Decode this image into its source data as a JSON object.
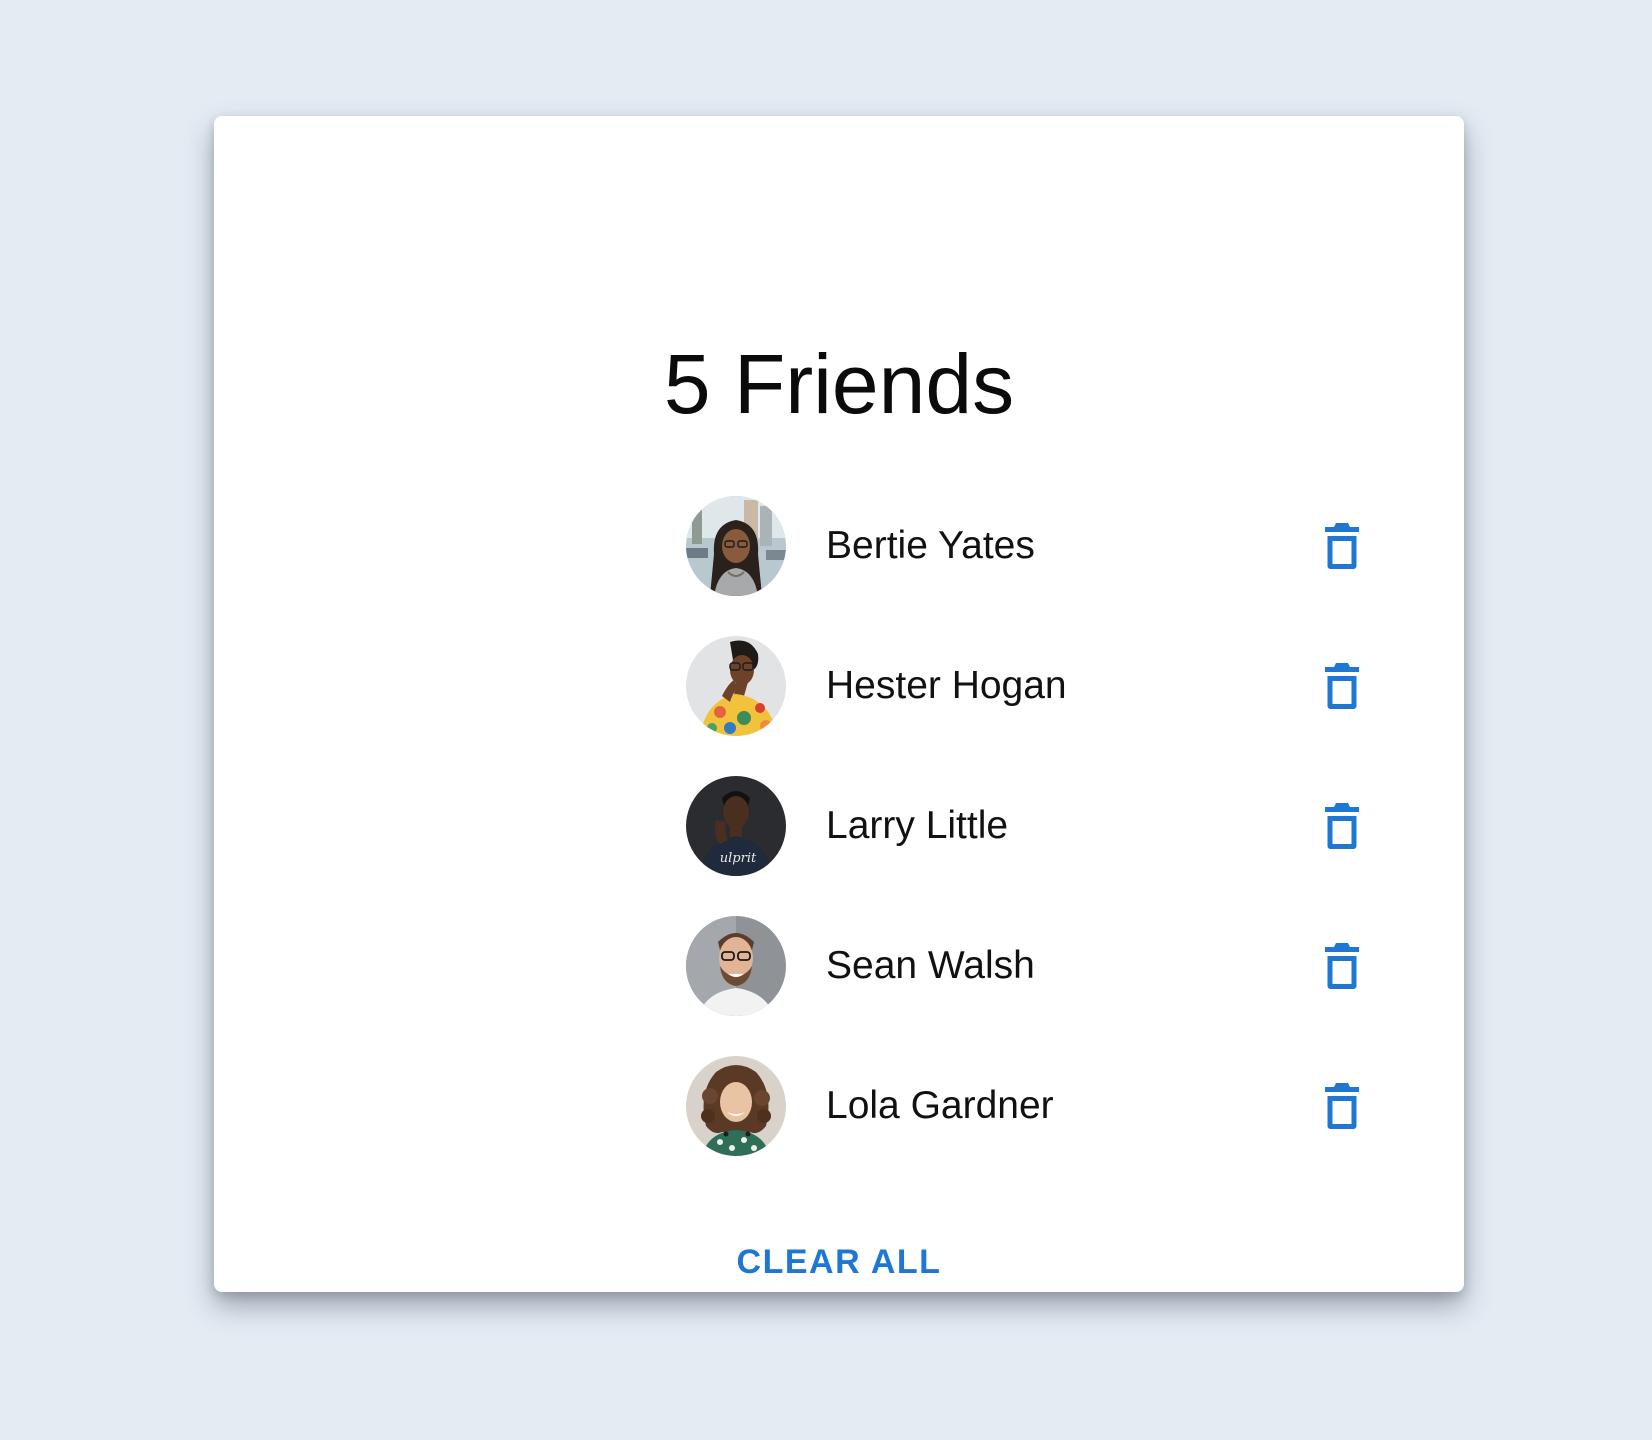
{
  "title": "5 Friends",
  "accent_color": "#1f77d4",
  "friends": [
    {
      "name": "Bertie Yates",
      "avatar": "avatar-photo-bertie",
      "delete_icon": "trash-icon"
    },
    {
      "name": "Hester Hogan",
      "avatar": "avatar-photo-hester",
      "delete_icon": "trash-icon"
    },
    {
      "name": "Larry Little",
      "avatar": "avatar-photo-larry",
      "delete_icon": "trash-icon"
    },
    {
      "name": "Sean Walsh",
      "avatar": "avatar-photo-sean",
      "delete_icon": "trash-icon"
    },
    {
      "name": "Lola Gardner",
      "avatar": "avatar-photo-lola",
      "delete_icon": "trash-icon"
    }
  ],
  "clear_all_label": "CLEAR ALL"
}
